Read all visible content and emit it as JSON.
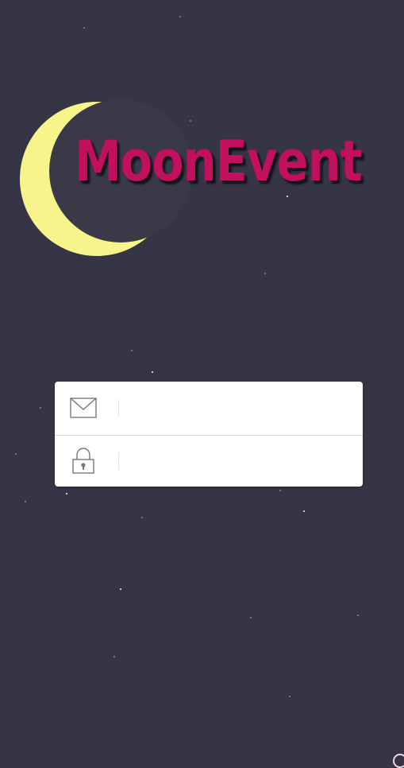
{
  "app": {
    "logo_text": "MoonEvent",
    "colors": {
      "background": "#363545",
      "moon": "#f7f48b",
      "logo_text": "#c20f5e",
      "card": "#ffffff"
    }
  },
  "login": {
    "email": {
      "icon": "envelope-icon",
      "value": "",
      "placeholder": ""
    },
    "password": {
      "icon": "padlock-icon",
      "value": "",
      "placeholder": ""
    }
  }
}
